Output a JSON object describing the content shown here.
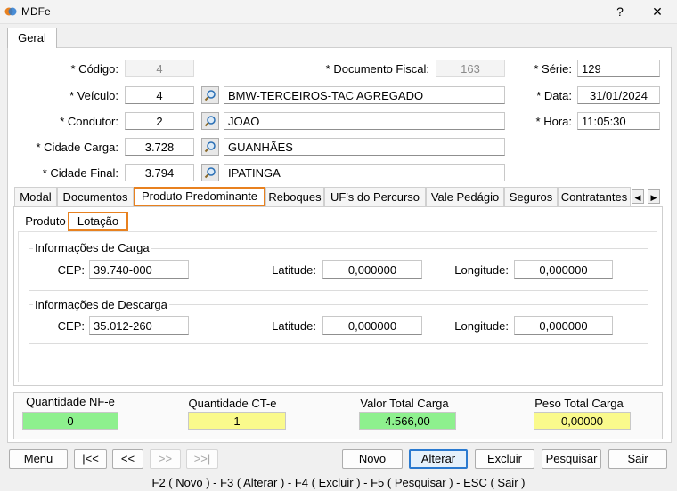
{
  "window": {
    "title": "MDFe",
    "help": "?",
    "close": "✕"
  },
  "tabs": {
    "geral": "Geral"
  },
  "form": {
    "codigo": {
      "label": "* Código:",
      "value": "4"
    },
    "documento_fiscal": {
      "label": "* Documento Fiscal:",
      "value": "163"
    },
    "serie": {
      "label": "* Série:",
      "value": "129"
    },
    "veiculo": {
      "label": "* Veículo:",
      "code": "4",
      "desc": "BMW-TERCEIROS-TAC AGREGADO"
    },
    "data": {
      "label": "* Data:",
      "value": "31/01/2024"
    },
    "condutor": {
      "label": "* Condutor:",
      "code": "2",
      "desc": "JOAO"
    },
    "hora": {
      "label": "* Hora:",
      "value": "11:05:30"
    },
    "cidade_carga": {
      "label": "* Cidade Carga:",
      "code": "3.728",
      "desc": "GUANHÃES"
    },
    "cidade_final": {
      "label": "* Cidade Final:",
      "code": "3.794",
      "desc": "IPATINGA"
    }
  },
  "inner_tabs": [
    "Modal",
    "Documentos",
    "Produto Predominante",
    "Reboques",
    "UF's do Percurso",
    "Vale Pedágio",
    "Seguros",
    "Contratantes"
  ],
  "sub_tabs": [
    "Produto",
    "Lotação"
  ],
  "carga": {
    "title": "Informações de Carga",
    "cep_label": "CEP:",
    "cep": "39.740-000",
    "lat_label": "Latitude:",
    "lat": "0,000000",
    "lon_label": "Longitude:",
    "lon": "0,000000"
  },
  "descarga": {
    "title": "Informações de Descarga",
    "cep_label": "CEP:",
    "cep": "35.012-260",
    "lat_label": "Latitude:",
    "lat": "0,000000",
    "lon_label": "Longitude:",
    "lon": "0,000000"
  },
  "totals": {
    "nfe": {
      "label": "Quantidade NF-e",
      "value": "0",
      "color": "#8ef08e"
    },
    "cte": {
      "label": "Quantidade CT-e",
      "value": "1",
      "color": "#fafa8c"
    },
    "valor": {
      "label": "Valor Total Carga",
      "value": "4.566,00",
      "color": "#8ef08e"
    },
    "peso": {
      "label": "Peso Total Carga",
      "value": "0,00000",
      "color": "#fafa8c"
    }
  },
  "buttons": {
    "menu": "Menu",
    "first": "|<<",
    "prev": "<<",
    "next": ">>",
    "last": ">>|",
    "novo": "Novo",
    "alterar": "Alterar",
    "excluir": "Excluir",
    "pesquisar": "Pesquisar",
    "sair": "Sair"
  },
  "hotkeys": "F2 ( Novo )  -  F3 ( Alterar )  -  F4 ( Excluir )  -  F5 ( Pesquisar )  -  ESC ( Sair )",
  "colors": {
    "accent_tab": "#e8811f",
    "focus": "#2a7ad0"
  }
}
